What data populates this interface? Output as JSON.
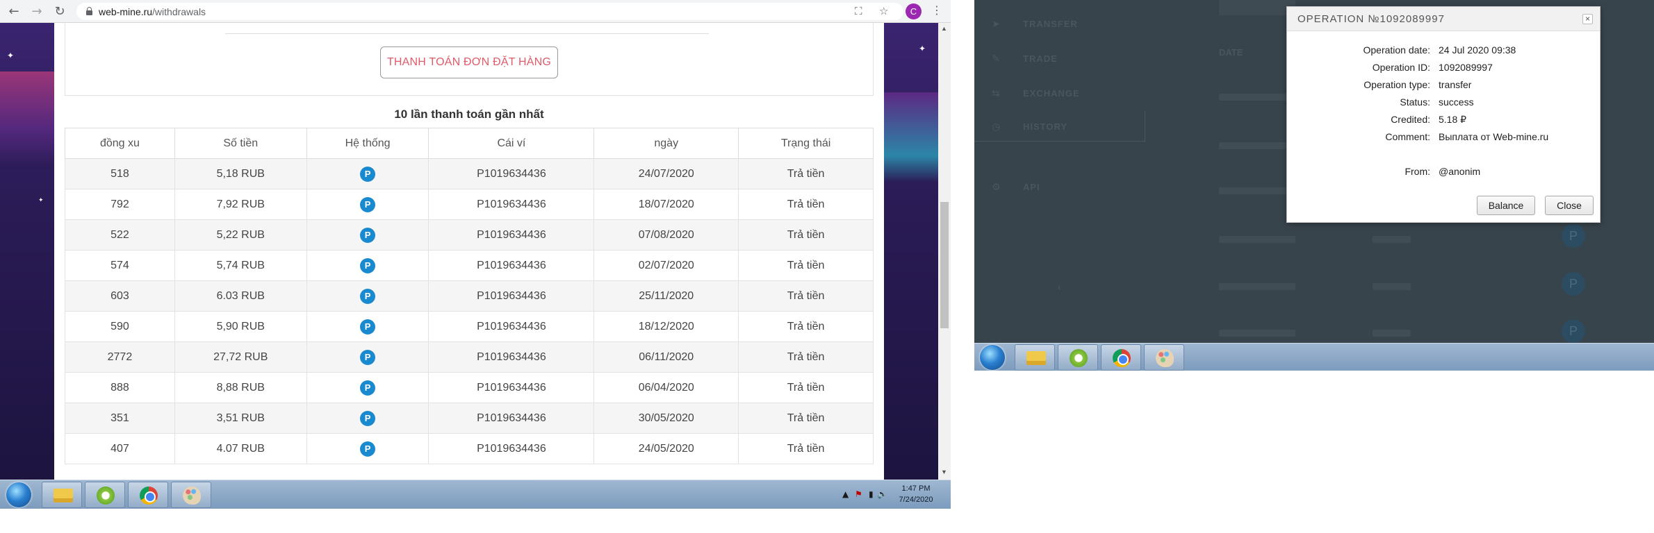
{
  "browser": {
    "url_domain": "web-mine.ru",
    "url_path": "/withdrawals",
    "profile_initial": "C",
    "icons": [
      "back-icon",
      "forward-icon",
      "reload-icon",
      "lock-icon",
      "translate-icon",
      "star-icon",
      "menu-icon"
    ]
  },
  "page": {
    "pay_button_label": "THANH TOÁN ĐƠN ĐẶT HÀNG",
    "table_title": "10 lần thanh toán gần nhất",
    "columns": [
      "đồng xu",
      "Số tiền",
      "Hệ thống",
      "Cái ví",
      "ngày",
      "Trạng thái"
    ],
    "system_icon_letter": "P",
    "rows": [
      {
        "coins": "518",
        "amount": "5,18 RUB",
        "wallet": "P1019634436",
        "date": "24/07/2020",
        "status": "Trả tiền"
      },
      {
        "coins": "792",
        "amount": "7,92 RUB",
        "wallet": "P1019634436",
        "date": "18/07/2020",
        "status": "Trả tiền"
      },
      {
        "coins": "522",
        "amount": "5,22 RUB",
        "wallet": "P1019634436",
        "date": "07/08/2020",
        "status": "Trả tiền"
      },
      {
        "coins": "574",
        "amount": "5,74 RUB",
        "wallet": "P1019634436",
        "date": "02/07/2020",
        "status": "Trả tiền"
      },
      {
        "coins": "603",
        "amount": "6.03 RUB",
        "wallet": "P1019634436",
        "date": "25/11/2020",
        "status": "Trả tiền"
      },
      {
        "coins": "590",
        "amount": "5,90 RUB",
        "wallet": "P1019634436",
        "date": "18/12/2020",
        "status": "Trả tiền"
      },
      {
        "coins": "2772",
        "amount": "27,72 RUB",
        "wallet": "P1019634436",
        "date": "06/11/2020",
        "status": "Trả tiền"
      },
      {
        "coins": "888",
        "amount": "8,88 RUB",
        "wallet": "P1019634436",
        "date": "06/04/2020",
        "status": "Trả tiền"
      },
      {
        "coins": "351",
        "amount": "3,51 RUB",
        "wallet": "P1019634436",
        "date": "30/05/2020",
        "status": "Trả tiền"
      },
      {
        "coins": "407",
        "amount": "4.07 RUB",
        "wallet": "P1019634436",
        "date": "24/05/2020",
        "status": "Trả tiền"
      }
    ],
    "colors": {
      "pay_button_text": "#e05a6a",
      "system_icon": "#1a8ad0"
    }
  },
  "taskbar_left": {
    "time": "1:47 PM",
    "date": "7/24/2020",
    "apps": [
      "start-orb",
      "folder-icon",
      "green-app-icon",
      "chrome-icon",
      "paint-icon"
    ]
  },
  "remote": {
    "nav": [
      "TRANSFER",
      "TRADE",
      "EXCHANGE",
      "HISTORY",
      "API"
    ],
    "date_header": "DATE",
    "modal": {
      "title": "OPERATION №1092089997",
      "fields": [
        {
          "label": "Operation date:",
          "value": "24 Jul 2020 09:38"
        },
        {
          "label": "Operation ID:",
          "value": "1092089997"
        },
        {
          "label": "Operation type:",
          "value": "transfer"
        },
        {
          "label": "Status:",
          "value": "success"
        },
        {
          "label": "Credited:",
          "value": "5.18 ₽"
        },
        {
          "label": "Comment:",
          "value": "Выплата от Web-mine.ru"
        },
        {
          "label": "From:",
          "value": "@anonim"
        }
      ],
      "balance_button": "Balance",
      "close_button": "Close"
    }
  }
}
